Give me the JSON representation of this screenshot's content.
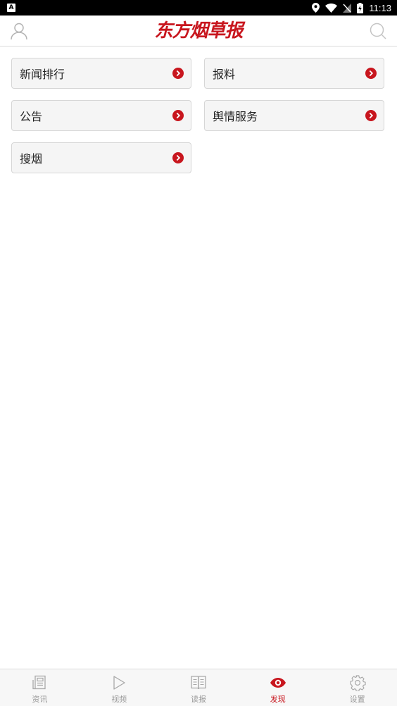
{
  "status_bar": {
    "left_icon_letter": "A",
    "time": "11:13",
    "icons": [
      "location-icon",
      "wifi-icon",
      "no-sim-icon",
      "battery-icon"
    ]
  },
  "header": {
    "logo_text": "东方烟草报",
    "left_icon": "user-icon",
    "right_icon": "search-icon"
  },
  "grid": {
    "items": [
      {
        "label": "新闻排行"
      },
      {
        "label": "报料"
      },
      {
        "label": "公告"
      },
      {
        "label": "舆情服务"
      },
      {
        "label": "搜烟"
      }
    ]
  },
  "tabs": [
    {
      "label": "资讯",
      "icon": "news-icon",
      "active": false
    },
    {
      "label": "视频",
      "icon": "play-icon",
      "active": false
    },
    {
      "label": "读报",
      "icon": "book-icon",
      "active": false
    },
    {
      "label": "发现",
      "icon": "eye-icon",
      "active": true
    },
    {
      "label": "设置",
      "icon": "gear-icon",
      "active": false
    }
  ],
  "colors": {
    "accent": "#c8161e",
    "tab_inactive": "#999999",
    "card_bg": "#f5f5f5"
  }
}
